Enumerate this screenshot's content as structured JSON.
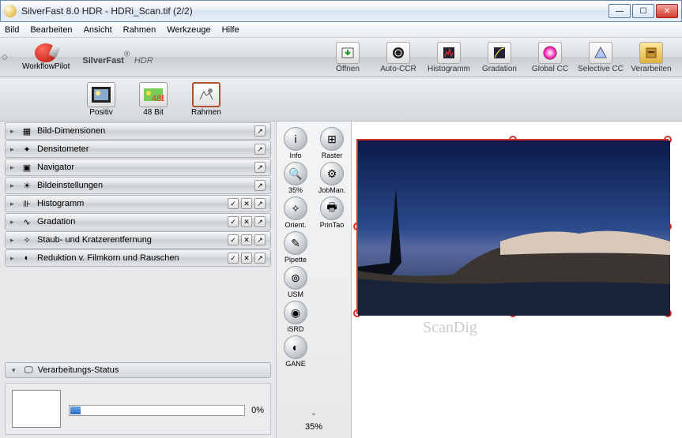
{
  "window": {
    "title": "SilverFast 8.0 HDR - HDRi_Scan.tif (2/2)"
  },
  "menu": [
    "Bild",
    "Bearbeiten",
    "Ansicht",
    "Rahmen",
    "Werkzeuge",
    "Hilfe"
  ],
  "brand": {
    "name": "SilverFast",
    "suffix": "HDR",
    "pilot": "WorkflowPilot"
  },
  "topButtons": [
    {
      "label": "Öffnen",
      "icon": "open-icon"
    },
    {
      "label": "Auto-CCR",
      "icon": "autoccr-icon"
    },
    {
      "label": "Histogramm",
      "icon": "histogram-icon"
    },
    {
      "label": "Gradation",
      "icon": "gradation-icon"
    },
    {
      "label": "Global CC",
      "icon": "globalcc-icon"
    },
    {
      "label": "Selective CC",
      "icon": "selectivecc-icon"
    },
    {
      "label": "Verarbeiten",
      "icon": "process-icon"
    }
  ],
  "subButtons": [
    {
      "label": "Positiv",
      "icon": "positiv-icon",
      "selected": false
    },
    {
      "label": "48 Bit",
      "icon": "48bit-icon",
      "selected": false
    },
    {
      "label": "Rahmen",
      "icon": "rahmen-icon",
      "selected": true
    }
  ],
  "panels": [
    {
      "label": "Bild-Dimensionen",
      "check": false,
      "x": false
    },
    {
      "label": "Densitometer",
      "check": false,
      "x": false
    },
    {
      "label": "Navigator",
      "check": false,
      "x": false
    },
    {
      "label": "Bildeinstellungen",
      "check": false,
      "x": false
    },
    {
      "label": "Histogramm",
      "check": true,
      "x": true
    },
    {
      "label": "Gradation",
      "check": true,
      "x": true
    },
    {
      "label": "Staub- und Kratzerentfernung",
      "check": true,
      "x": true
    },
    {
      "label": "Reduktion v. Filmkorn und Rauschen",
      "check": true,
      "x": true
    }
  ],
  "status": {
    "header": "Verarbeitungs-Status",
    "percent": "0%"
  },
  "midTools": [
    [
      {
        "label": "Info",
        "glyph": "i"
      },
      {
        "label": "Raster",
        "glyph": "⊞"
      }
    ],
    [
      {
        "label": "35%",
        "glyph": "🔍"
      },
      {
        "label": "JobMan.",
        "glyph": "⚙"
      }
    ],
    [
      {
        "label": "Orient.",
        "glyph": "✧"
      },
      {
        "label": "PrinTao",
        "glyph": "🖶"
      }
    ],
    [
      {
        "label": "Pipette",
        "glyph": "✎"
      }
    ],
    [
      {
        "label": "USM",
        "glyph": "⊚"
      }
    ],
    [
      {
        "label": "iSRD",
        "glyph": "◉"
      }
    ],
    [
      {
        "label": "GANE",
        "glyph": "◐"
      }
    ]
  ],
  "midFooter": {
    "chevron": "ˇ",
    "zoom": "35%"
  },
  "watermark": "ScanDig",
  "preview": {
    "frameNum": "2"
  }
}
